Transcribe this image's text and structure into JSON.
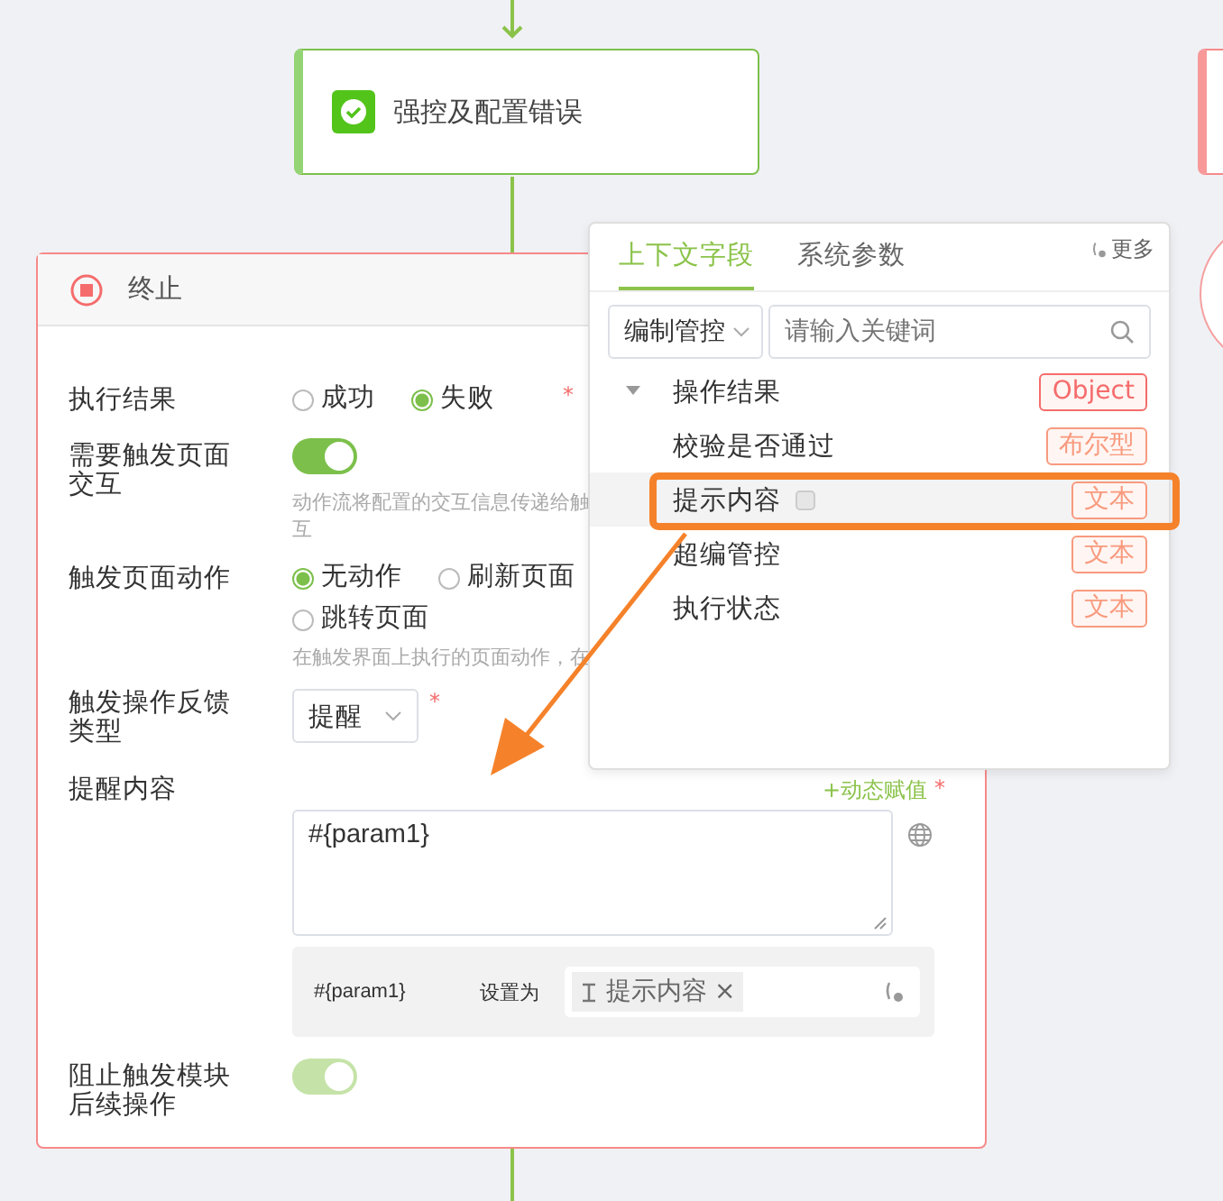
{
  "flow": {
    "node": {
      "title": "强控及配置错误"
    }
  },
  "panel": {
    "title": "终止",
    "fields": [
      {
        "kind": "radio",
        "label": "执行结果",
        "required_mark": "*",
        "options": [
          {
            "label": "成功",
            "selected": false
          },
          {
            "label": "失败",
            "selected": true
          }
        ]
      },
      {
        "kind": "toggle",
        "label": "需要触发页面交互",
        "on": true,
        "disabled": false,
        "hint_lines": [
          "动作流将配置的交互信息传递给触",
          "互"
        ]
      },
      {
        "kind": "radio",
        "label": "触发页面动作",
        "options": [
          {
            "label": "无动作",
            "selected": true
          },
          {
            "label": "刷新页面",
            "selected": false
          },
          {
            "label": "跳转页面",
            "selected": false
          }
        ],
        "hint_lines": [
          "在触发界面上执行的页面动作，在"
        ]
      },
      {
        "kind": "select",
        "label": "触发操作反馈类型",
        "value": "提醒",
        "required_mark": "*"
      },
      {
        "kind": "textarea",
        "label": "提醒内容",
        "action": "+动态赋值",
        "required_mark": "*",
        "value": "#{param1}",
        "mapping": {
          "param": "#{param1}",
          "connector": "设置为",
          "tag": "提示内容",
          "close": "×"
        }
      },
      {
        "kind": "toggle",
        "label": "阻止触发模块后续操作",
        "on": true,
        "disabled": true
      }
    ]
  },
  "popover": {
    "tabs": [
      {
        "label": "上下文字段",
        "selected": true
      },
      {
        "label": "系统参数",
        "selected": false
      }
    ],
    "more": "更多",
    "filter": {
      "value": "编制管控"
    },
    "search": {
      "placeholder": "请输入关键词"
    },
    "tree": [
      {
        "label": "操作结果",
        "type": "Object",
        "color": "#f56c6c",
        "expanded": true,
        "selected": false,
        "children": [
          {
            "label": "校验是否通过",
            "type": "布尔型",
            "color": "#f89a7e",
            "selected": false
          },
          {
            "label": "提示内容",
            "type": "文本",
            "color": "#f89a7e",
            "selected": true
          },
          {
            "label": "超编管控",
            "type": "文本",
            "color": "#f89a7e",
            "selected": false
          },
          {
            "label": "执行状态",
            "type": "文本",
            "color": "#f89a7e",
            "selected": false
          }
        ]
      }
    ]
  }
}
